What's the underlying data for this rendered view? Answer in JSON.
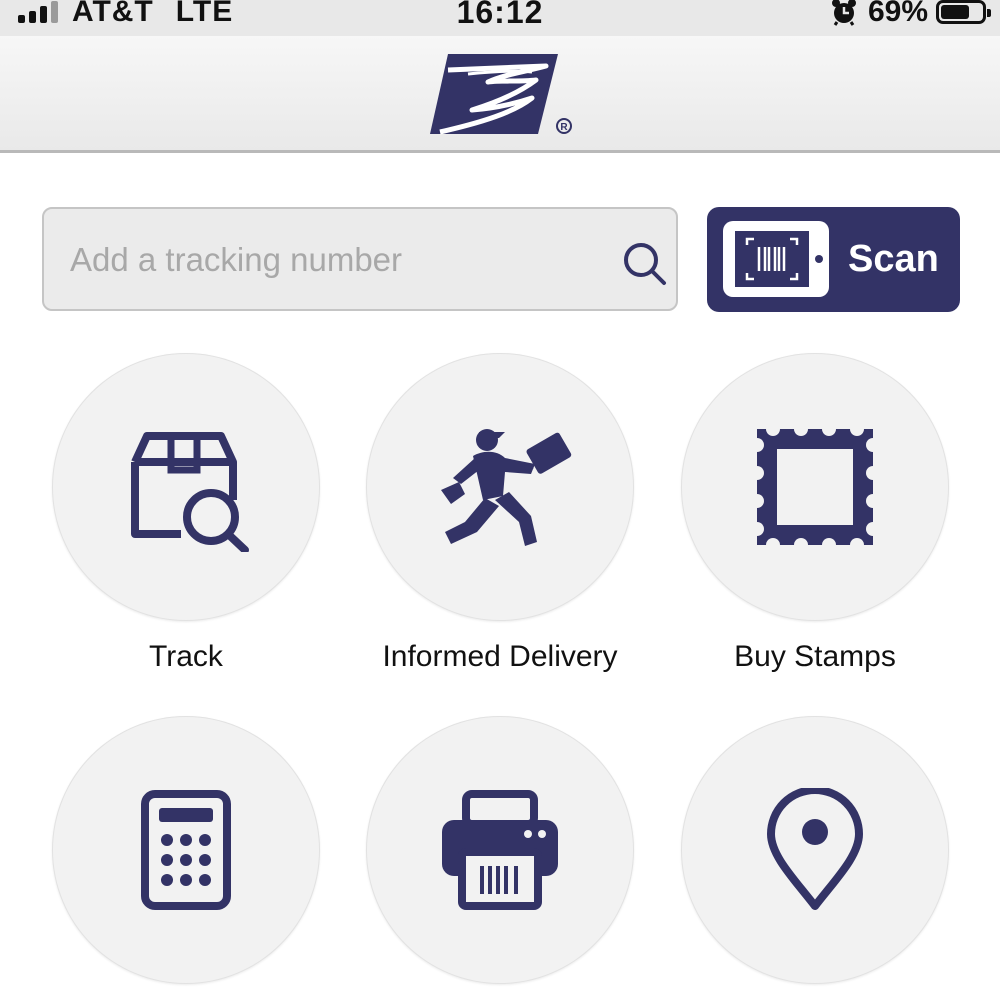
{
  "status_bar": {
    "carrier": "AT&T",
    "network": "LTE",
    "time": "16:12",
    "battery": "69%"
  },
  "header": {
    "logo_icon": "usps-eagle-logo"
  },
  "search": {
    "placeholder": "Add a tracking number",
    "value": "",
    "icon": "search-icon"
  },
  "scan": {
    "label": "Scan",
    "icon": "scan-device-icon"
  },
  "tiles": [
    {
      "label": "Track",
      "icon": "package-search-icon"
    },
    {
      "label": "Informed Delivery",
      "icon": "mail-carrier-icon"
    },
    {
      "label": "Buy Stamps",
      "icon": "stamp-icon"
    },
    {
      "label": "",
      "icon": "calculator-icon"
    },
    {
      "label": "",
      "icon": "printer-icon"
    },
    {
      "label": "",
      "icon": "location-pin-icon"
    }
  ],
  "colors": {
    "brand_navy": "#333366",
    "background": "#ffffff",
    "tile_background": "#f2f2f2"
  }
}
